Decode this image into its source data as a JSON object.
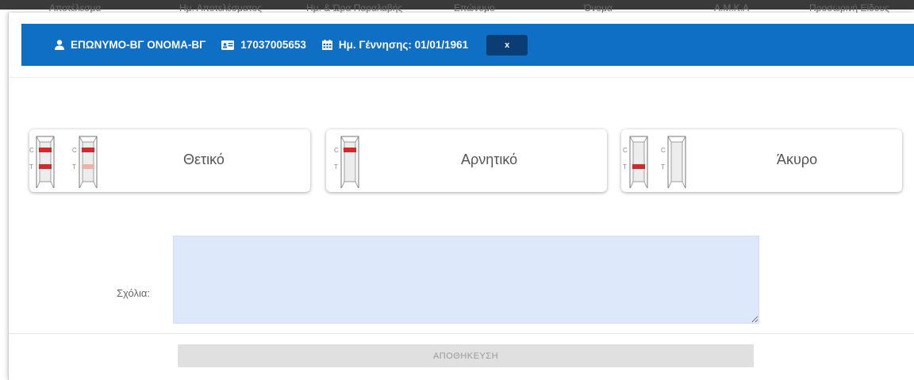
{
  "background_columns": [
    "Αποτέλεσμα",
    "Ημ. Αποτελέσματος",
    "Ημ. & Ώρα Παραλαβής",
    "Επώνυμο",
    "Όνομα",
    "Α.Μ.Κ.Α",
    "Προσωρινή Είδους"
  ],
  "header": {
    "patient_name": "ΕΠΩΝΥΜΟ-ΒΓ ΟΝΟΜΑ-ΒΓ",
    "id_number": "17037005653",
    "birth_date": "Ημ. Γέννησης: 01/01/1961",
    "close_label": "x",
    "color": "#0f6fc5"
  },
  "results": {
    "positive_label": "Θετικό",
    "negative_label": "Αρνητικό",
    "invalid_label": "Άκυρο",
    "c_letter": "C",
    "t_letter": "T",
    "line_color": "#d02a2a"
  },
  "comments": {
    "label": "Σχόλια:",
    "value": ""
  },
  "save": {
    "label": "ΑΠΟΘΗΚΕΥΣΗ"
  }
}
